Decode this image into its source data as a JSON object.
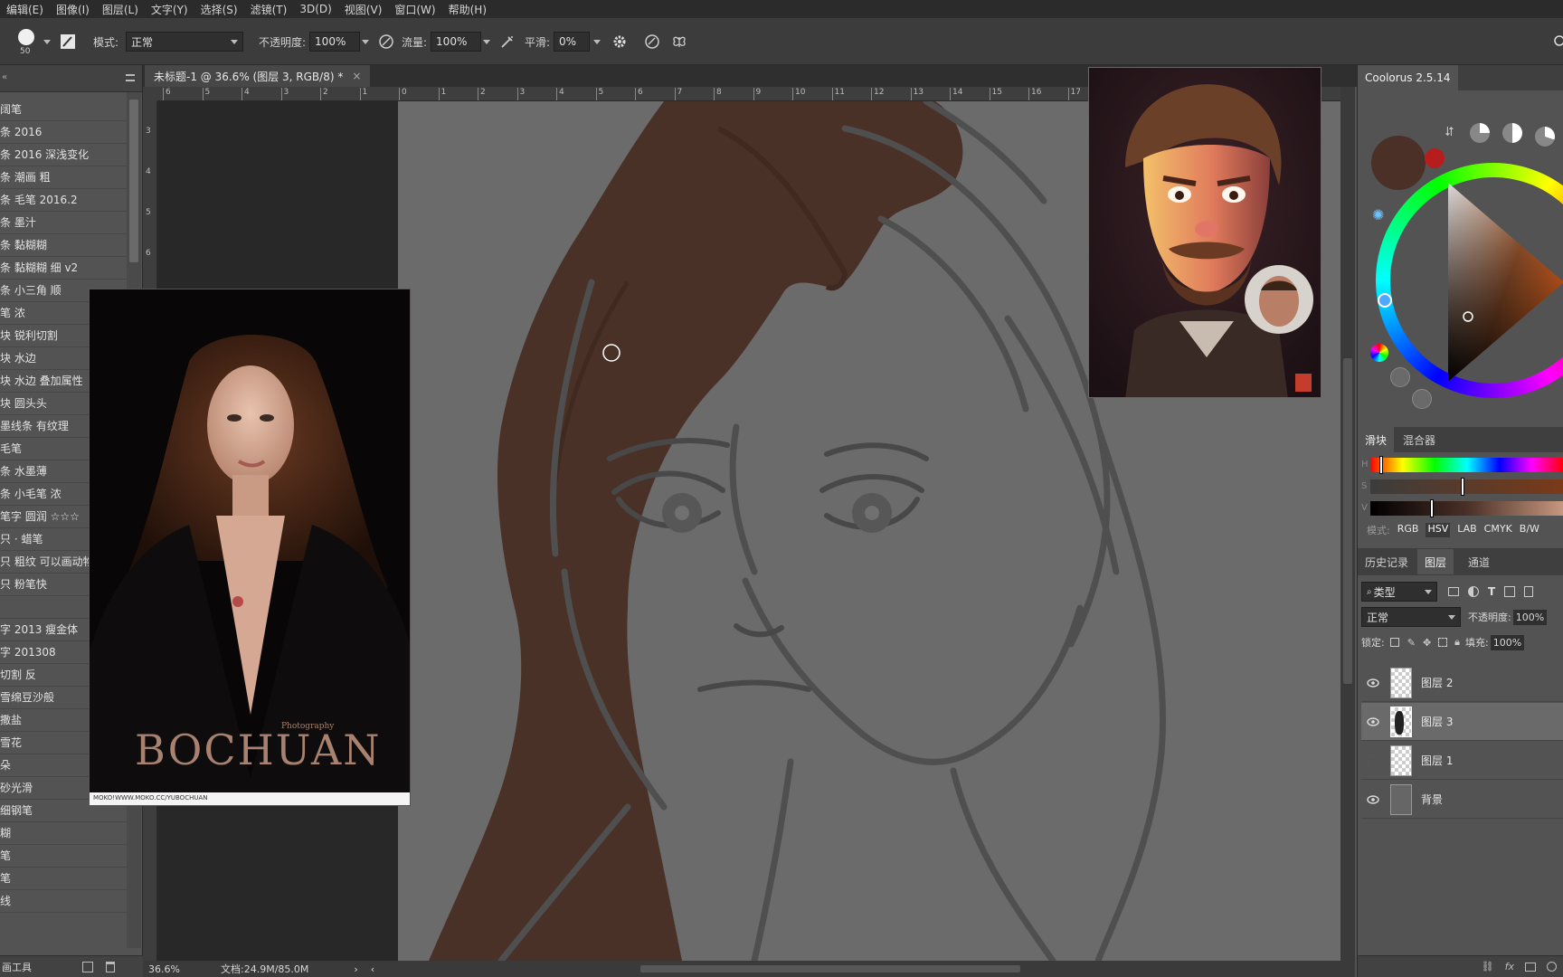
{
  "menu": [
    "编辑(E)",
    "图像(I)",
    "图层(L)",
    "文字(Y)",
    "选择(S)",
    "滤镜(T)",
    "3D(D)",
    "视图(V)",
    "窗口(W)",
    "帮助(H)"
  ],
  "options": {
    "brush_size": "50",
    "mode_label": "模式:",
    "mode_value": "正常",
    "opacity_label": "不透明度:",
    "opacity_value": "100%",
    "flow_label": "流量:",
    "flow_value": "100%",
    "smooth_label": "平滑:",
    "smooth_value": "0%"
  },
  "brushes": [
    "阔笔",
    "条 2016",
    "条 2016 深浅变化",
    "条 潮画 粗",
    "条 毛笔 2016.2",
    "条 墨汁",
    "条 黏糊糊",
    "条 黏糊糊 细 v2",
    "条 小三角 顺",
    "笔 浓",
    "块 锐利切割",
    "块 水边",
    "块 水边 叠加属性",
    "块 圆头头",
    "墨线条 有纹理",
    "毛笔",
    "条 水墨薄",
    "条 小毛笔 浓",
    "笔字 圆润 ☆☆☆",
    "只 · 蜡笔",
    "只 粗纹 可以画动物",
    "只 粉笔快",
    "",
    "字 2013 瘦金体",
    "字 201308",
    "切割 反",
    "雪绵豆沙般",
    "撒盐",
    "雪花",
    "朵",
    "砂光滑",
    "细钢笔",
    "糊",
    "笔",
    "笔",
    "线"
  ],
  "brush_footer": "画工具",
  "document": {
    "tab_title": "未标题-1 @ 36.6% (图层 3, RGB/8) *",
    "zoom": "36.6%",
    "doc_size": "文档:24.9M/85.0M"
  },
  "reference_photo": {
    "brand": "BOCHUAN",
    "subtitle": "Photography",
    "url_footer": "MOKO!WWW.MOKO.CC/YUBOCHUAN"
  },
  "coolorus": {
    "title": "Coolorus 2.5.14",
    "tabs": [
      "滑块",
      "混合器"
    ],
    "slider_labels": [
      "H",
      "S",
      "V"
    ],
    "mode_label": "模式:",
    "modes": [
      "RGB",
      "HSV",
      "LAB",
      "CMYK",
      "B/W"
    ],
    "current_color": "#4a3027"
  },
  "layers_panel": {
    "tabs": [
      "历史记录",
      "图层",
      "通道"
    ],
    "filter_label": "类型",
    "blend_mode": "正常",
    "opacity_label": "不透明度:",
    "opacity_value": "100%",
    "lock_label": "锁定:",
    "fill_label": "填充:",
    "fill_value": "100%",
    "layers": [
      {
        "name": "图层 2",
        "visible": true,
        "selected": false
      },
      {
        "name": "图层 3",
        "visible": true,
        "selected": true
      },
      {
        "name": "图层 1",
        "visible": false,
        "selected": false
      },
      {
        "name": "背景",
        "visible": true,
        "selected": false
      }
    ]
  },
  "rulers": {
    "h_ticks": [
      "6",
      "5",
      "4",
      "3",
      "2",
      "1",
      "0",
      "1",
      "2",
      "3",
      "4",
      "5",
      "6",
      "7",
      "8",
      "9",
      "10",
      "11",
      "12",
      "13",
      "14",
      "15",
      "16",
      "17"
    ],
    "v_ticks": [
      "3",
      "4",
      "5",
      "6"
    ]
  },
  "colors": {
    "hair": "#4a3127",
    "canvas_gray": "#6b6b6b",
    "sketch": "#4f4f4f",
    "accent": "#5b8fd6"
  }
}
